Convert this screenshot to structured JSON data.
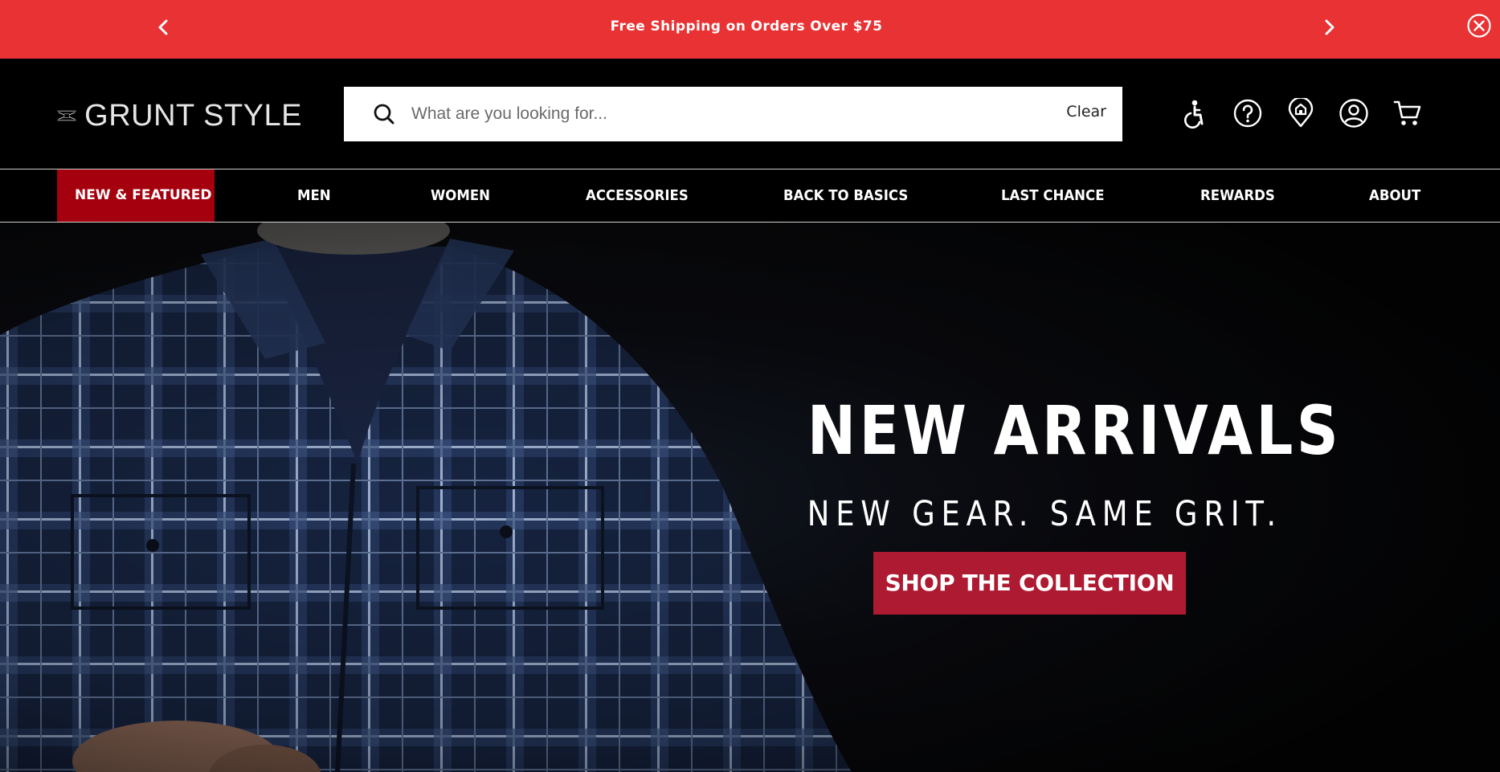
{
  "announcement": {
    "message": "Free Shipping on Orders Over $75",
    "prev_icon": "chevron-left-icon",
    "next_icon": "chevron-right-icon",
    "close_icon": "close-circle-icon",
    "background": "#e93234"
  },
  "header": {
    "logo_text": "GRUNT STYLE",
    "search": {
      "placeholder": "What are you looking for...",
      "value": "",
      "clear_label": "Clear"
    },
    "icons": [
      "accessibility-icon",
      "help-icon",
      "store-locator-icon",
      "account-icon",
      "cart-icon"
    ]
  },
  "nav": {
    "items": [
      {
        "label": "NEW & FEATURED",
        "active": true
      },
      {
        "label": "MEN"
      },
      {
        "label": "WOMEN"
      },
      {
        "label": "ACCESSORIES"
      },
      {
        "label": "BACK TO BASICS"
      },
      {
        "label": "LAST CHANCE"
      },
      {
        "label": "REWARDS"
      },
      {
        "label": "ABOUT"
      }
    ],
    "active_color": "#a5000d"
  },
  "hero": {
    "headline": "NEW ARRIVALS",
    "subheadline": "NEW GEAR. SAME GRIT.",
    "cta_label": "SHOP THE COLLECTION",
    "cta_color": "#ad1a31"
  }
}
